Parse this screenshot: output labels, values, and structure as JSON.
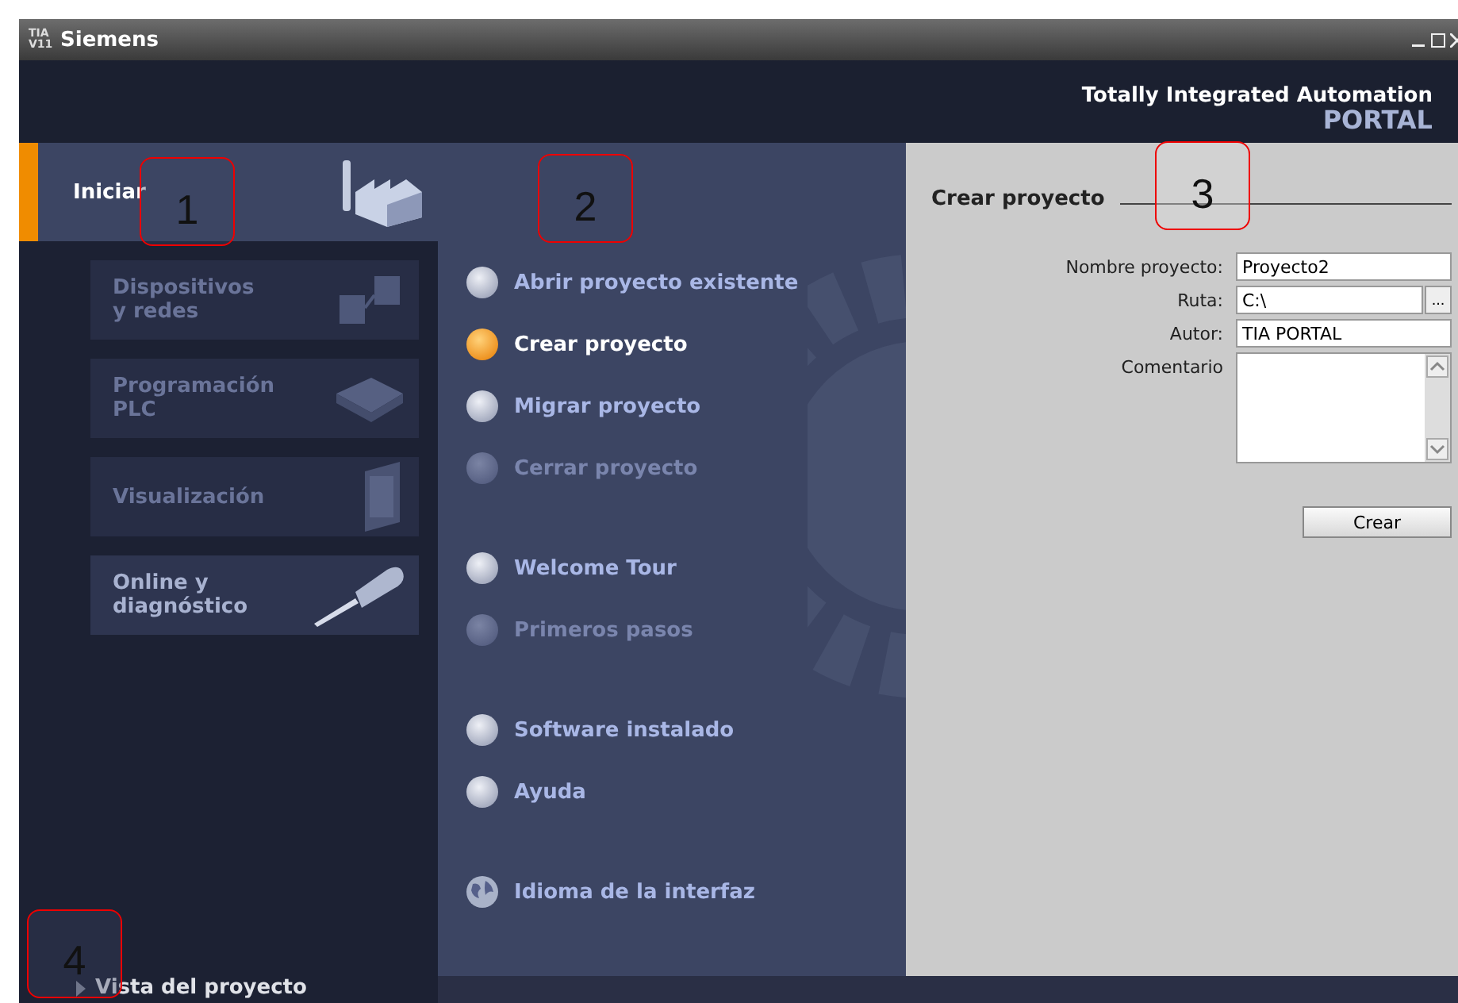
{
  "window": {
    "logo": "TIA V11",
    "title": "Siemens"
  },
  "header": {
    "tagline": "Totally Integrated Automation",
    "product": "PORTAL"
  },
  "portals": [
    {
      "label": "Iniciar",
      "kind": "main",
      "selected": true,
      "disabled": false
    },
    {
      "label": "Dispositivos y redes",
      "kind": "devices",
      "selected": false,
      "disabled": true
    },
    {
      "label": "Programación PLC",
      "kind": "plc",
      "selected": false,
      "disabled": true
    },
    {
      "label": "Visualización",
      "kind": "hmi",
      "selected": false,
      "disabled": true
    },
    {
      "label": "Online y diagnóstico",
      "kind": "online",
      "selected": false,
      "disabled": false
    }
  ],
  "actions": [
    [
      {
        "label": "Abrir proyecto existente",
        "kind": "bullet",
        "selected": false,
        "disabled": false
      },
      {
        "label": "Crear proyecto",
        "kind": "bullet",
        "selected": true,
        "disabled": false
      },
      {
        "label": "Migrar proyecto",
        "kind": "bullet",
        "selected": false,
        "disabled": false
      },
      {
        "label": "Cerrar proyecto",
        "kind": "bullet",
        "selected": false,
        "disabled": true
      }
    ],
    [
      {
        "label": "Welcome Tour",
        "kind": "bullet",
        "selected": false,
        "disabled": false
      },
      {
        "label": "Primeros pasos",
        "kind": "bullet",
        "selected": false,
        "disabled": true
      }
    ],
    [
      {
        "label": "Software instalado",
        "kind": "bullet",
        "selected": false,
        "disabled": false
      },
      {
        "label": "Ayuda",
        "kind": "bullet",
        "selected": false,
        "disabled": false
      }
    ],
    [
      {
        "label": "Idioma de la interfaz",
        "kind": "globe",
        "selected": false,
        "disabled": false
      }
    ]
  ],
  "form": {
    "title": "Crear proyecto",
    "fields": [
      {
        "label": "Nombre proyecto:",
        "value": "Proyecto2",
        "kind": "text"
      },
      {
        "label": "Ruta:",
        "value": "C:\\",
        "kind": "browse",
        "button": "..."
      },
      {
        "label": "Autor:",
        "value": "TIA PORTAL",
        "kind": "text"
      },
      {
        "label": "Comentario",
        "kind": "multiline"
      }
    ],
    "submit": "Crear"
  },
  "project_view": {
    "label": "Vista del proyecto"
  },
  "annotations": [
    {
      "label": "1"
    },
    {
      "label": "2"
    },
    {
      "label": "3"
    },
    {
      "label": "4"
    }
  ]
}
